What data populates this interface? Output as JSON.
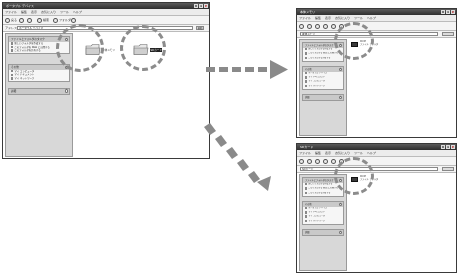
{
  "main_window": {
    "title": "ポータブル デバイス",
    "menu": [
      "ファイル",
      "編集",
      "表示",
      "お気に入り",
      "ツール",
      "ヘルプ"
    ],
    "toolbar": {
      "back": "戻る",
      "search": "検索",
      "folders": "フォルダ"
    },
    "address": {
      "label": "アドレス",
      "value": "ポータブル デバイス",
      "go": "移動"
    },
    "tasks": {
      "title": "ファイルとフォルダのタスク",
      "items": [
        "新しいフォルダを作成する",
        "このフォルダを Web に公開する",
        "このフォルダを共有する"
      ]
    },
    "places": {
      "title": "その他",
      "items": [
        "マイ コンピュータ",
        "マイ ドキュメント",
        "マイ ネットワーク"
      ]
    },
    "details": {
      "title": "詳細"
    },
    "folders": [
      "本体メモリ",
      "SDカード"
    ]
  },
  "top_window": {
    "title": "本体メモリ",
    "menu": [
      "ファイル",
      "編集",
      "表示",
      "お気に入り",
      "ツール",
      "ヘルプ"
    ],
    "address_value": "本体メモリ",
    "tasks_title": "ファイルとフォルダのタスク",
    "tasks_items": [
      "新しいフォルダを作成する",
      "このフォルダを Web に公開する",
      "このフォルダを共有する"
    ],
    "places_title": "その他",
    "places_items": [
      "ポータブル デバイス",
      "マイ ドキュメント",
      "マイ コンピュータ",
      "マイ ネットワーク"
    ],
    "details_title": "詳細",
    "file_name": "DCIM",
    "file_info": "ファイル フォルダ"
  },
  "bottom_window": {
    "title": "SDカード",
    "menu": [
      "ファイル",
      "編集",
      "表示",
      "お気に入り",
      "ツール",
      "ヘルプ"
    ],
    "address_value": "SDカード",
    "tasks_title": "ファイルとフォルダのタスク",
    "tasks_items": [
      "新しいフォルダを作成する",
      "このフォルダを Web に公開する",
      "このフォルダを共有する"
    ],
    "places_title": "その他",
    "places_items": [
      "ポータブル デバイス",
      "マイ ドキュメント",
      "マイ コンピュータ",
      "マイ ネットワーク"
    ],
    "details_title": "詳細",
    "file_name": "DCIM",
    "file_info": "ファイル フォルダ"
  },
  "colors": {
    "dashed_circle": "#8c8c8c",
    "arrow": "#8a8a8a",
    "titlebar": "#3a3a3a"
  }
}
